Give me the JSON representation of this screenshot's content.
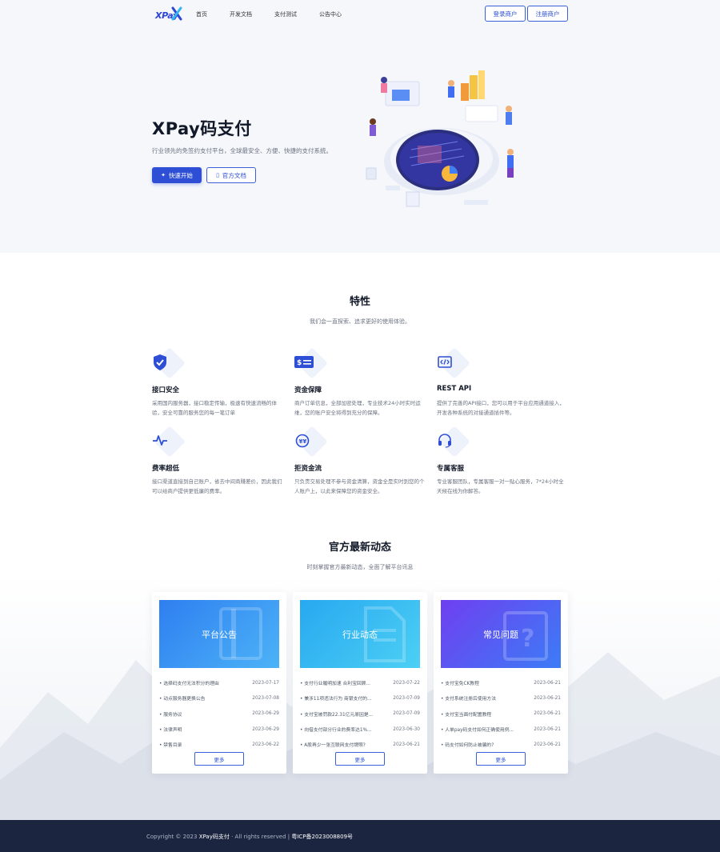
{
  "nav": {
    "logo": "XPay",
    "links": [
      "首页",
      "开发文档",
      "支付测试",
      "公告中心"
    ],
    "login": "登录商户",
    "register": "注册商户"
  },
  "hero": {
    "title": "XPay码支付",
    "subtitle": "行业领先的免签约支付平台，全球最安全、方便、快捷的支付系统。",
    "start_btn": "快速开始",
    "docs_btn": "官方文档"
  },
  "features": {
    "title": "特性",
    "subtitle": "我们会一直探索、追求更好的使用体验。",
    "items": [
      {
        "title": "接口安全",
        "desc": "采用国内服务器，接口稳定传输，极速有快速流畅的体验，安全可靠的服务您的每一笔订单"
      },
      {
        "title": "资金保障",
        "desc": "商户订单信息，全部加密处理，专业技术24小时实时运维，您的账户安全将得到充分的保障。"
      },
      {
        "title": "REST API",
        "desc": "提供了完善的API接口，您可以用于平台应用通道接入，开发各种系统的对接通道插件等。"
      },
      {
        "title": "费率超低",
        "desc": "接口渠道直接到自己账户，省去中间商赚差价，因此我们可以给商户提供更低廉的费率。"
      },
      {
        "title": "拒资金流",
        "desc": "只负责交易处理不参与资金清算，资金全是实时到您的个人账户上，以此来保障您的资金安全。"
      },
      {
        "title": "专属客服",
        "desc": "专业客服团队，专属客服一对一贴心服务，7*24小时全天候在线为你解答。"
      }
    ]
  },
  "news": {
    "title": "官方最新动态",
    "subtitle": "时刻掌握官方最新动态，全面了解平台讯息",
    "more_label": "更多",
    "cards": [
      {
        "banner": "平台公告",
        "color_from": "#2f7ff0",
        "color_to": "#4cb3f7",
        "items": [
          {
            "t": "选择码支付无法积分的理由",
            "d": "2023-07-17"
          },
          {
            "t": "动点服务器更换公告",
            "d": "2023-07-08"
          },
          {
            "t": "服务协议",
            "d": "2023-06-29"
          },
          {
            "t": "法律声明",
            "d": "2023-06-29"
          },
          {
            "t": "禁售目录",
            "d": "2023-06-22"
          }
        ]
      },
      {
        "banner": "行业动态",
        "color_from": "#28a8f0",
        "color_to": "#4cd0f4",
        "items": [
          {
            "t": "支付行业履明加速 合利宝回顾...",
            "d": "2023-07-22"
          },
          {
            "t": "兼涉11项违法行为 商银支付的...",
            "d": "2023-07-09"
          },
          {
            "t": "支付宝被罚款22.31亿元原因是...",
            "d": "2023-07-09"
          },
          {
            "t": "向借支付部分行业的费率达1%...",
            "d": "2023-06-30"
          },
          {
            "t": "A股再少一张互联网支付牌照?",
            "d": "2023-06-21"
          }
        ]
      },
      {
        "banner": "常见问题",
        "color_from": "#6f3ff0",
        "color_to": "#3c7cf6",
        "items": [
          {
            "t": "支付宝免CK教程",
            "d": "2023-06-21"
          },
          {
            "t": "支付系统注册后使用方法",
            "d": "2023-06-21"
          },
          {
            "t": "支付宝当面付配置教程",
            "d": "2023-06-21"
          },
          {
            "t": "人单pay码支付如何正确使用例...",
            "d": "2023-06-21"
          },
          {
            "t": "码支付如何防止被骗的?",
            "d": "2023-06-21"
          }
        ]
      }
    ]
  },
  "footer": {
    "prefix": "Copyright © 2023",
    "brand": "XPay码支付",
    "middle": "· All rights reserved |",
    "icp": "粤ICP备2023008809号"
  }
}
